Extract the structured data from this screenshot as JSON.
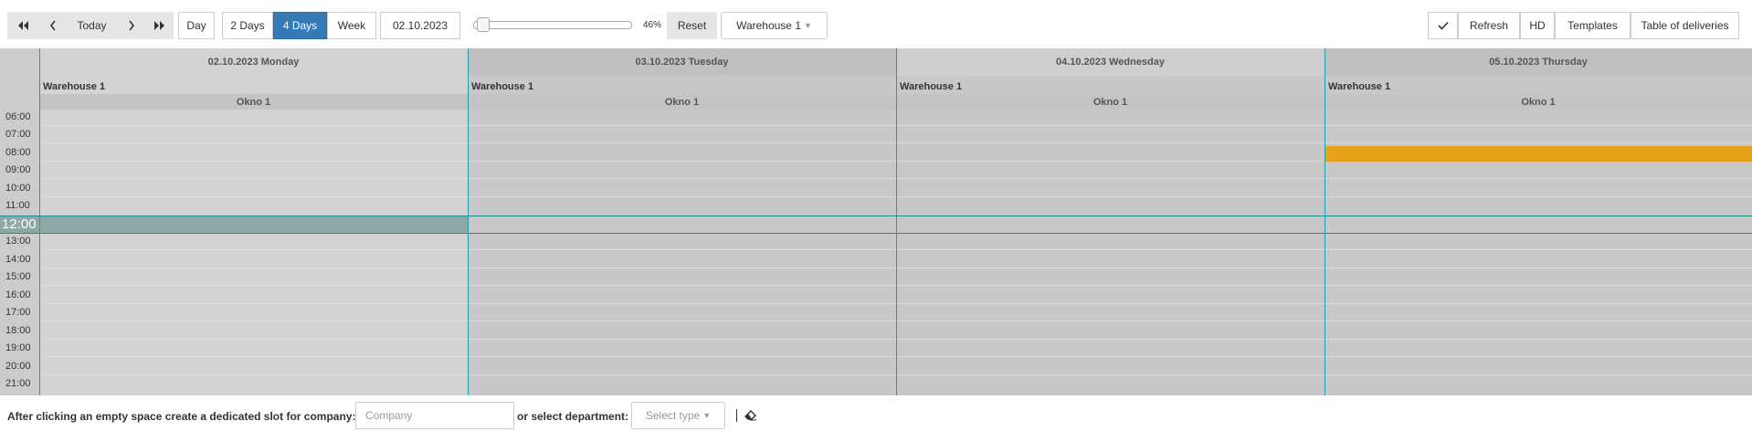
{
  "toolbar": {
    "first_icon": "double-chevron-left-icon",
    "prev_icon": "chevron-left-icon",
    "today_label": "Today",
    "next_icon": "chevron-right-icon",
    "last_icon": "double-chevron-right-icon",
    "views": [
      "Day",
      "2 Days",
      "4 Days",
      "Week"
    ],
    "active_view": "4 Days",
    "date_value": "02.10.2023",
    "zoom_percent": 46,
    "zoom_label": "46%",
    "reset_label": "Reset",
    "warehouse_select": "Warehouse 1",
    "confirm_icon": "check-icon",
    "refresh_label": "Refresh",
    "hd_label": "HD",
    "templates_label": "Templates",
    "deliveries_label": "Table of deliveries"
  },
  "calendar": {
    "days": [
      {
        "header": "02.10.2023 Monday",
        "warehouse": "Warehouse 1",
        "dock": "Okno 1"
      },
      {
        "header": "03.10.2023 Tuesday",
        "warehouse": "Warehouse 1",
        "dock": "Okno 1"
      },
      {
        "header": "04.10.2023 Wednesday",
        "warehouse": "Warehouse 1",
        "dock": "Okno 1"
      },
      {
        "header": "05.10.2023 Thursday",
        "warehouse": "Warehouse 1",
        "dock": "Okno 1"
      }
    ],
    "hours": [
      "06:00",
      "07:00",
      "08:00",
      "09:00",
      "10:00",
      "11:00",
      "12:00",
      "13:00",
      "14:00",
      "15:00",
      "16:00",
      "17:00",
      "18:00",
      "19:00",
      "20:00",
      "21:00"
    ],
    "current_hour": "12:00",
    "events": [
      {
        "day_index": 3,
        "start": "08:00",
        "end": "09:00",
        "color": "#e8a21b"
      }
    ]
  },
  "footer": {
    "prompt_label": "After clicking an empty space create a dedicated slot for company:",
    "company_placeholder": "Company",
    "or_label": "or select department:",
    "type_placeholder": "Select type",
    "eraser_icon": "eraser-icon"
  },
  "colors": {
    "accent": "#337ab7",
    "event": "#e8a21b",
    "current_time": "#8ea9a5",
    "grid_border": "#2a9aa6"
  }
}
